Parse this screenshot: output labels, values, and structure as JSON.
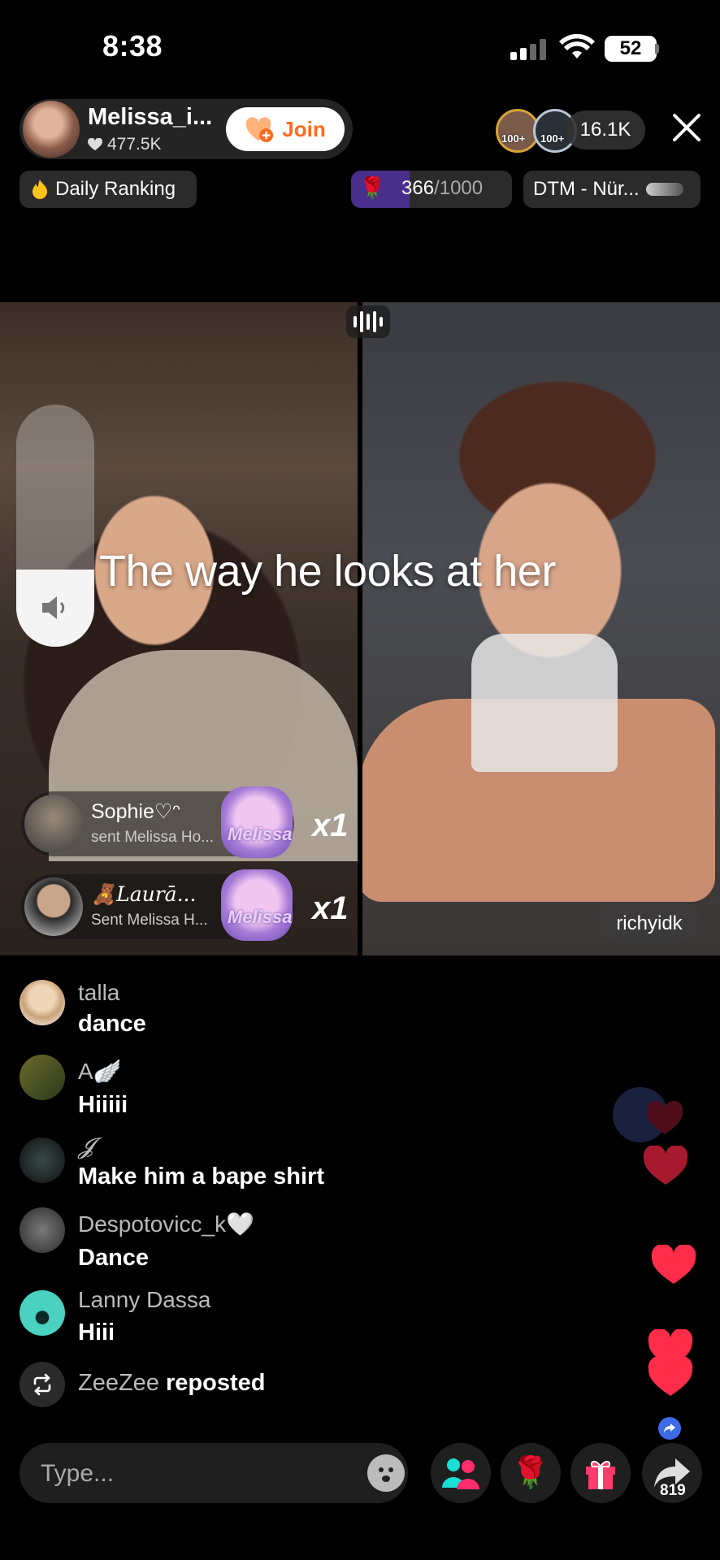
{
  "status_bar": {
    "time": "8:38",
    "battery": "52"
  },
  "host": {
    "name": "Melissa_i...",
    "likes": "477.5K",
    "join_label": "Join"
  },
  "viewers": {
    "badge_1": "100+",
    "badge_2": "100+",
    "count": "16.1K"
  },
  "ranking": {
    "label": "Daily Ranking"
  },
  "goal": {
    "current": "366",
    "total": "/1000",
    "progress": 0.366,
    "icon": "rose"
  },
  "promo": {
    "label": "DTM - Nür..."
  },
  "caption": "The way he looks at her",
  "volume": {
    "level": 0.32
  },
  "gifts": [
    {
      "name": "Sophie♡ᵔ",
      "text": "sent Melissa Ho...",
      "gift_label": "Melissa",
      "multiplier": "x1"
    },
    {
      "name": "🧸Laurā...",
      "text": "Sent Melissa H...",
      "gift_label": "Melissa",
      "multiplier": "x1"
    }
  ],
  "partner": {
    "name": "richyidk"
  },
  "comments": [
    {
      "user": "talla",
      "text": "dance"
    },
    {
      "user": "A🪽",
      "text": "Hiiiii"
    },
    {
      "user": "𝓙",
      "text": "Make him a bape shirt"
    },
    {
      "user": "Despotovicc_k🤍",
      "text": "Dance"
    },
    {
      "user": "Lanny Dassa",
      "text": "Hiii"
    }
  ],
  "repost": {
    "user": "ZeeZee",
    "action": "reposted"
  },
  "bottom_bar": {
    "placeholder": "Type...",
    "share_count": "819"
  },
  "colors": {
    "accent_orange": "#ff6a1f",
    "heart_red": "#ff2d4a",
    "goal_purple": "#4a2e8c",
    "share_blue": "#3b6be6"
  }
}
